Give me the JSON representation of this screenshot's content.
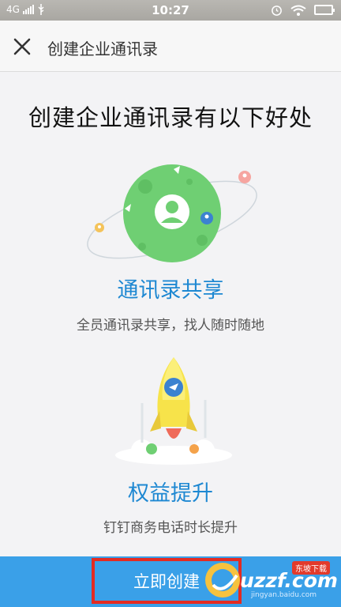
{
  "status_bar": {
    "network": "4G",
    "time": "10:27"
  },
  "header": {
    "title": "创建企业通讯录"
  },
  "heading": "创建企业通讯录有以下好处",
  "features": [
    {
      "title": "通讯录共享",
      "desc": "全员通讯录共享，找人随时随地"
    },
    {
      "title": "权益提升",
      "desc": "钉钉商务电话时长提升"
    }
  ],
  "cta": {
    "label": "立即创建"
  },
  "watermark": {
    "brand": "uzzf.com",
    "tag": "东坡下载",
    "sub": "jingyan.baidu.com"
  },
  "colors": {
    "accent": "#1e88d2",
    "button": "#3aa0e8",
    "highlight_box": "#e32b22",
    "planet": "#6fcf73"
  }
}
